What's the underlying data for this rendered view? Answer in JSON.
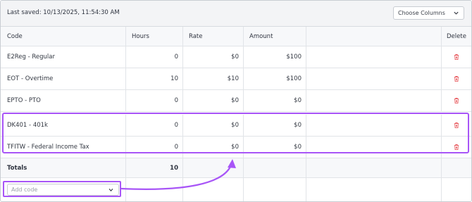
{
  "header": {
    "last_saved": "Last saved: 10/13/2025, 11:54:30 AM",
    "choose_columns": "Choose Columns"
  },
  "table": {
    "columns": {
      "code": "Code",
      "hours": "Hours",
      "rate": "Rate",
      "amount": "Amount",
      "delete": "Delete"
    },
    "rows": [
      {
        "code": "E2Reg - Regular",
        "hours": "0",
        "rate": "$0",
        "amount": "$100"
      },
      {
        "code": "EOT - Overtime",
        "hours": "10",
        "rate": "$10",
        "amount": "$100"
      },
      {
        "code": "EPTO - PTO",
        "hours": "0",
        "rate": "$0",
        "amount": "$0"
      },
      {
        "code": "DK401 - 401k",
        "hours": "0",
        "rate": "$0",
        "amount": "$0"
      },
      {
        "code": "TFITW - Federal Income Tax",
        "hours": "0",
        "rate": "$0",
        "amount": "$0"
      }
    ],
    "totals": {
      "label": "Totals",
      "hours": "10"
    }
  },
  "add_code": {
    "placeholder": "Add code"
  },
  "colors": {
    "highlight": "#a855f7",
    "delete_icon": "#e5484d"
  },
  "icons": {
    "delete": "trash-icon",
    "dropdown": "chevron-down-icon"
  }
}
